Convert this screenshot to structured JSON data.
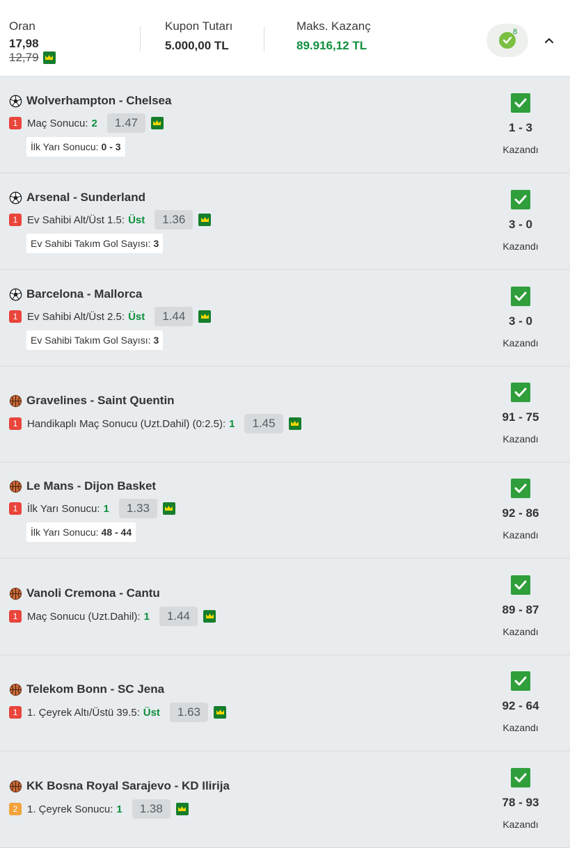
{
  "summary": {
    "oran_label": "Oran",
    "oran_value": "17,98",
    "oran_old": "12,79",
    "kupon_label": "Kupon Tutarı",
    "kupon_value": "5.000,00 TL",
    "maks_label": "Maks. Kazanç",
    "maks_value": "89.916,12 TL",
    "badge_count": "8"
  },
  "colors": {
    "win_green": "#0f8f3d",
    "badge_red": "#e9453b",
    "badge_orange": "#f2a33a",
    "check_green": "#2f9e3b"
  },
  "matches": [
    {
      "sport_icon": "soccer-ball-icon",
      "name": "Wolverhampton - Chelsea",
      "bet_no": "1",
      "bet_label": "Maç Sonucu:",
      "selection": "2",
      "odd": "1.47",
      "info_label": "İlk Yarı Sonucu:",
      "info_value": "0 - 3",
      "score": "1 - 3",
      "status": "Kazandı"
    },
    {
      "sport_icon": "soccer-ball-icon",
      "name": "Arsenal - Sunderland",
      "bet_no": "1",
      "bet_label": "Ev Sahibi Alt/Üst 1.5:",
      "selection": "Üst",
      "odd": "1.36",
      "info_label": "Ev Sahibi Takım Gol Sayısı:",
      "info_value": "3",
      "score": "3 - 0",
      "status": "Kazandı"
    },
    {
      "sport_icon": "soccer-ball-icon",
      "name": "Barcelona - Mallorca",
      "bet_no": "1",
      "bet_label": "Ev Sahibi Alt/Üst 2.5:",
      "selection": "Üst",
      "odd": "1.44",
      "info_label": "Ev Sahibi Takım Gol Sayısı:",
      "info_value": "3",
      "score": "3 - 0",
      "status": "Kazandı"
    },
    {
      "sport_icon": "basketball-icon",
      "name": "Gravelines - Saint Quentin",
      "bet_no": "1",
      "bet_label": "Handikaplı Maç Sonucu (Uzt.Dahil) (0:2.5):",
      "selection": "1",
      "odd": "1.45",
      "score": "91 - 75",
      "status": "Kazandı"
    },
    {
      "sport_icon": "basketball-icon",
      "name": "Le Mans - Dijon Basket",
      "bet_no": "1",
      "bet_label": "İlk Yarı Sonucu:",
      "selection": "1",
      "odd": "1.33",
      "info_label": "İlk Yarı Sonucu:",
      "info_value": "48 - 44",
      "score": "92 - 86",
      "status": "Kazandı"
    },
    {
      "sport_icon": "basketball-icon",
      "name": "Vanoli Cremona - Cantu",
      "bet_no": "1",
      "bet_label": "Maç Sonucu (Uzt.Dahil):",
      "selection": "1",
      "odd": "1.44",
      "score": "89 - 87",
      "status": "Kazandı"
    },
    {
      "sport_icon": "basketball-icon",
      "name": "Telekom Bonn - SC Jena",
      "bet_no": "1",
      "bet_label": "1. Çeyrek Altı/Üstü 39.5:",
      "selection": "Üst",
      "odd": "1.63",
      "score": "92 - 64",
      "status": "Kazandı"
    },
    {
      "sport_icon": "basketball-icon",
      "name": "KK Bosna Royal Sarajevo - KD Ilirija",
      "bet_no": "2",
      "bet_label": "1. Çeyrek Sonucu:",
      "selection": "1",
      "odd": "1.38",
      "score": "78 - 93",
      "status": "Kazandı"
    }
  ]
}
